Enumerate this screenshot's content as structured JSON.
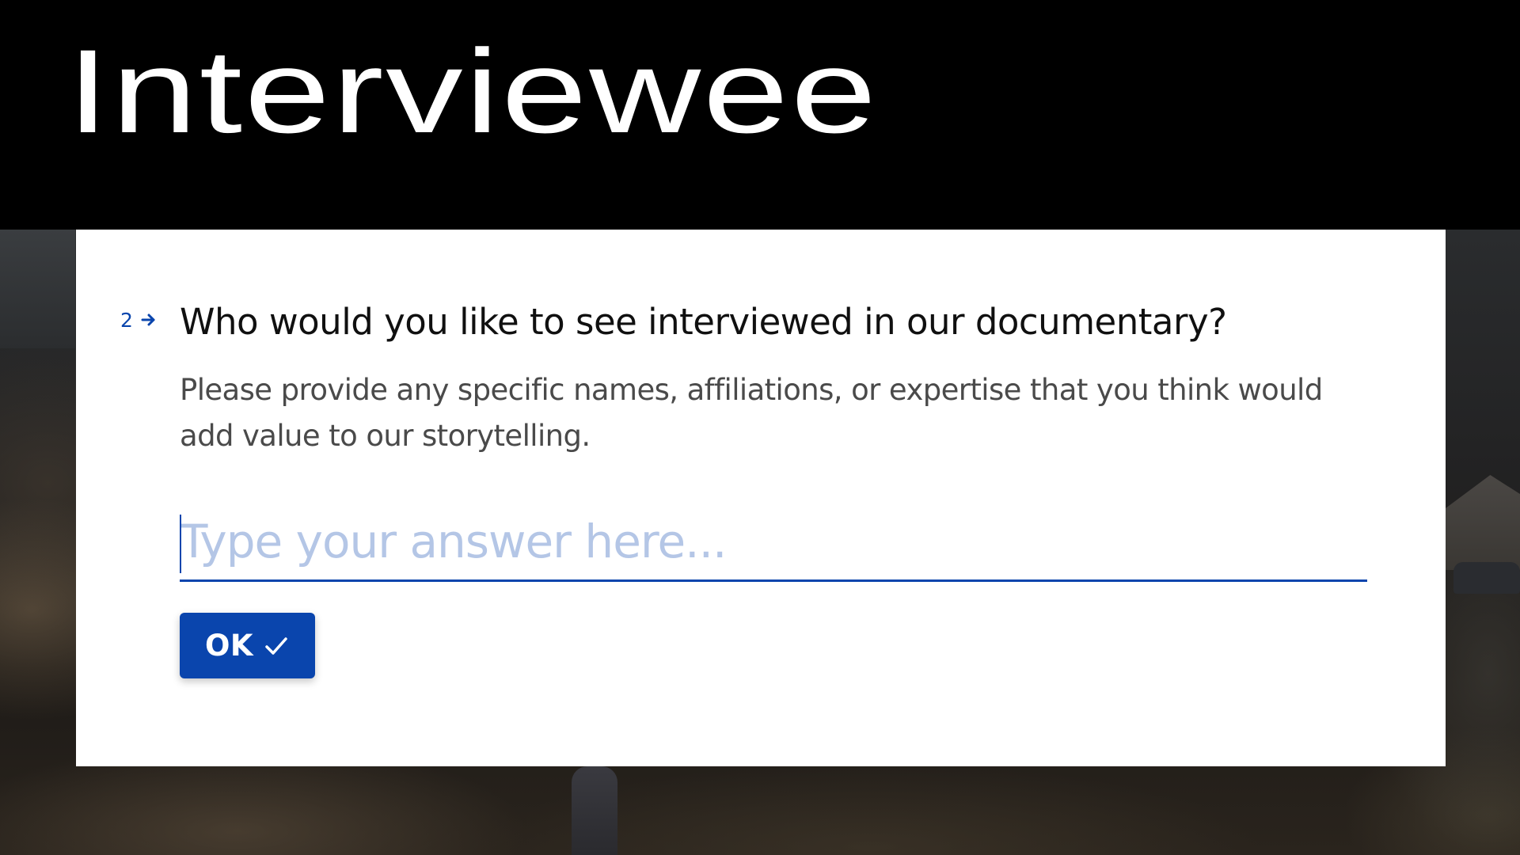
{
  "header": {
    "title": "Interviewee"
  },
  "question": {
    "number": "2",
    "title": "Who would you like to see interviewed in our documentary?",
    "description": "Please provide any specific names, affiliations, or expertise that you think would add value to our storytelling."
  },
  "answer": {
    "value": "",
    "placeholder": "Type your answer here..."
  },
  "submit": {
    "label": "OK"
  },
  "icons": {
    "question_arrow": "arrow-right-icon",
    "submit_check": "checkmark-icon"
  },
  "colors": {
    "accent": "#0a45ad",
    "placeholder": "#b4c6e6",
    "question_text": "#101010",
    "description_text": "#4a4a4a",
    "header_bg": "#000000",
    "card_bg": "#ffffff"
  }
}
